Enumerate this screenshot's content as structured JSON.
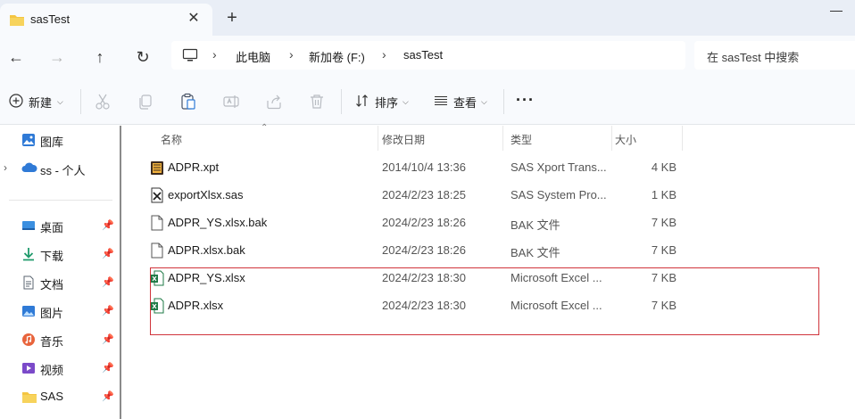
{
  "window": {
    "tab_title": "sasTest",
    "new_tab": "+",
    "close": "✕"
  },
  "address_bar": {
    "breadcrumbs": [
      "此电脑",
      "新加卷 (F:)",
      "sasTest"
    ],
    "search_placeholder": "在 sasTest 中搜索"
  },
  "toolbar": {
    "new_label": "新建",
    "sort_label": "排序",
    "view_label": "查看",
    "more_label": "···"
  },
  "sidebar": {
    "items": [
      {
        "label": "图库",
        "icon": "gallery-icon",
        "pinned": false
      },
      {
        "label": "ss - 个人",
        "icon": "onedrive-icon",
        "pinned": false,
        "expandable": true
      },
      {
        "label": "桌面",
        "icon": "desktop-icon",
        "pinned": true
      },
      {
        "label": "下载",
        "icon": "download-icon",
        "pinned": true
      },
      {
        "label": "文档",
        "icon": "documents-icon",
        "pinned": true
      },
      {
        "label": "图片",
        "icon": "pictures-icon",
        "pinned": true
      },
      {
        "label": "音乐",
        "icon": "music-icon",
        "pinned": true
      },
      {
        "label": "视频",
        "icon": "videos-icon",
        "pinned": true
      },
      {
        "label": "SAS",
        "icon": "folder-icon",
        "pinned": true
      }
    ]
  },
  "columns": {
    "name": "名称",
    "date": "修改日期",
    "type": "类型",
    "size": "大小"
  },
  "files": [
    {
      "name": "ADPR.xpt",
      "date": "2014/10/4 13:36",
      "type": "SAS Xport Trans...",
      "size": "4 KB",
      "icon": "sas-xport-icon"
    },
    {
      "name": "exportXlsx.sas",
      "date": "2024/2/23 18:25",
      "type": "SAS System Pro...",
      "size": "1 KB",
      "icon": "sas-program-icon"
    },
    {
      "name": "ADPR_YS.xlsx.bak",
      "date": "2024/2/23 18:26",
      "type": "BAK 文件",
      "size": "7 KB",
      "icon": "file-icon"
    },
    {
      "name": "ADPR.xlsx.bak",
      "date": "2024/2/23 18:26",
      "type": "BAK 文件",
      "size": "7 KB",
      "icon": "file-icon"
    },
    {
      "name": "ADPR_YS.xlsx",
      "date": "2024/2/23 18:30",
      "type": "Microsoft Excel ...",
      "size": "7 KB",
      "icon": "excel-icon"
    },
    {
      "name": "ADPR.xlsx",
      "date": "2024/2/23 18:30",
      "type": "Microsoft Excel ...",
      "size": "7 KB",
      "icon": "excel-icon"
    }
  ],
  "colors": {
    "highlight_border": "#d0343b",
    "folder_yellow": "#f4c542",
    "excel_green": "#1d7a45",
    "onedrive_blue": "#2f7ad6"
  }
}
